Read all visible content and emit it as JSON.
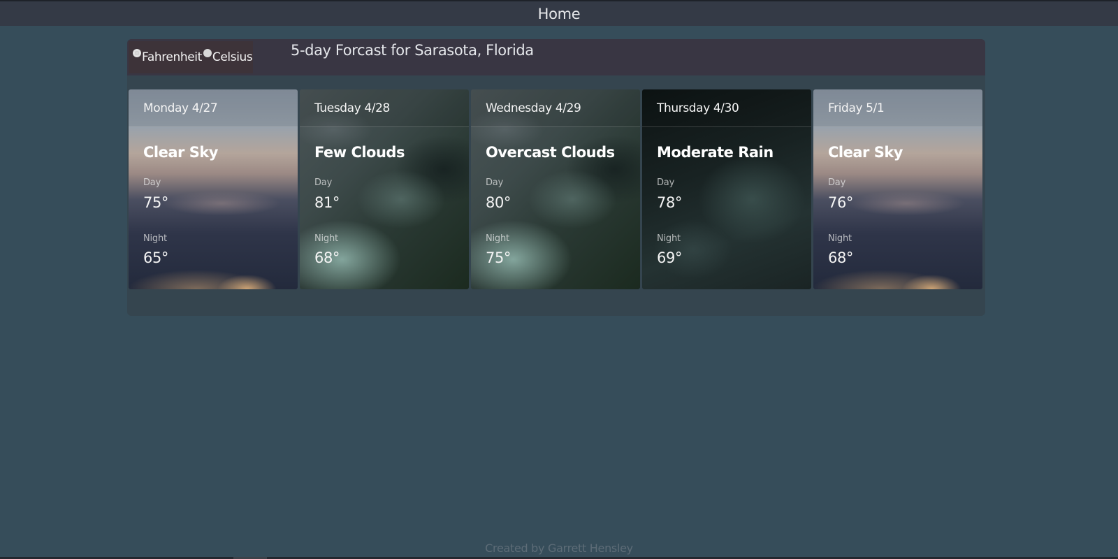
{
  "nav": {
    "home_label": "Home"
  },
  "units": {
    "options": [
      {
        "label": "Fahrenheit",
        "checked": true
      },
      {
        "label": "Celsius",
        "checked": false
      }
    ]
  },
  "forecast": {
    "title": "5-day Forcast for Sarasota, Florida",
    "day_label": "Day",
    "night_label": "Night",
    "days": [
      {
        "date": "Monday 4/27",
        "condition": "Clear Sky",
        "day_temp": "75°",
        "night_temp": "65°",
        "scene": "clear-sky-icon"
      },
      {
        "date": "Tuesday 4/28",
        "condition": "Few Clouds",
        "day_temp": "81°",
        "night_temp": "68°",
        "scene": "clouds-icon"
      },
      {
        "date": "Wednesday 4/29",
        "condition": "Overcast Clouds",
        "day_temp": "80°",
        "night_temp": "75°",
        "scene": "clouds-icon"
      },
      {
        "date": "Thursday 4/30",
        "condition": "Moderate Rain",
        "day_temp": "78°",
        "night_temp": "69°",
        "scene": "rain-icon"
      },
      {
        "date": "Friday 5/1",
        "condition": "Clear Sky",
        "day_temp": "76°",
        "night_temp": "68°",
        "scene": "clear-sky-icon"
      }
    ]
  },
  "footer": {
    "credit": "Created by Garrett Hensley"
  },
  "colors": {
    "page_background": "#364d5a",
    "topbar": "#343a46",
    "panel": "#35454f",
    "panel_header": "#393643",
    "footer_text": "#5d6c77"
  }
}
